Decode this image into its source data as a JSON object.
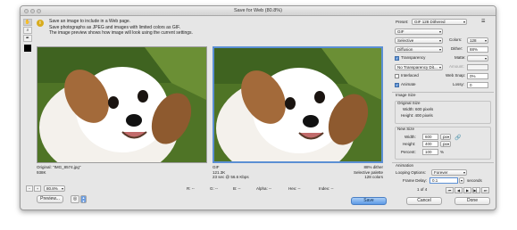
{
  "window": {
    "title": "Save for Web (80.8%)"
  },
  "info": {
    "lines": [
      "Save an image to include in a Web page.",
      "Save photographs as JPEG and images with limited colors as GIF.",
      "The image preview shows how image will look using the current settings."
    ]
  },
  "tools": [
    {
      "name": "hand-tool",
      "glyph": "✋"
    },
    {
      "name": "zoom-tool",
      "glyph": "⌕"
    },
    {
      "name": "eyedropper-tool",
      "glyph": "✒"
    }
  ],
  "original": {
    "line1": "Original: \"IMG_8574.jpg\"",
    "line2": "938K"
  },
  "optimized": {
    "left1": "GIF",
    "left2": "121.3K",
    "left3": "23 sec @ 56.6 Kbps",
    "right1": "88% dither",
    "right2": "Selective palette",
    "right3": "128 colors"
  },
  "bottom": {
    "zoom": "80.8%",
    "r": "R: --",
    "g": "G: --",
    "b": "B: --",
    "alpha": "Alpha: --",
    "hex": "Hex: --",
    "index": "Index: --"
  },
  "buttons": {
    "preview": "Preview...",
    "save": "Save",
    "cancel": "Cancel",
    "done": "Done"
  },
  "panel": {
    "preset_label": "Preset:",
    "preset_value": "GIF 128 Dithered",
    "format": "GIF",
    "reduction": "Selective",
    "dither_algo": "Diffusion",
    "colors_label": "Colors:",
    "colors": "128",
    "dither_label": "Dither:",
    "dither": "88%",
    "transparency": "Transparency",
    "matte_label": "Matte:",
    "trans_dither": "No Transparency Dit...",
    "amount_label": "Amount:",
    "interlaced": "Interlaced",
    "websnap_label": "Web Snap:",
    "websnap": "0%",
    "animate": "Animate",
    "lossy_label": "Lossy:",
    "lossy": "0",
    "image_size": "Image Size",
    "original_size": "Original Size",
    "orig_width": "Width:  600 pixels",
    "orig_height": "Height:  400 pixels",
    "new_size": "New Size",
    "width_label": "Width:",
    "width": "600",
    "height_label": "Height:",
    "height": "400",
    "unit": "px",
    "percent_label": "Percent:",
    "percent": "100",
    "percent_unit": "%",
    "animation": "Animation",
    "looping_label": "Looping Options:",
    "looping": "Forever",
    "frame_delay_label": "Frame Delay:",
    "frame_delay": "0.1",
    "seconds": "seconds",
    "frame_counter": "1 of 4"
  },
  "colors": {
    "accent": "#5b8fd4",
    "info_icon": "#d8ac1e"
  }
}
